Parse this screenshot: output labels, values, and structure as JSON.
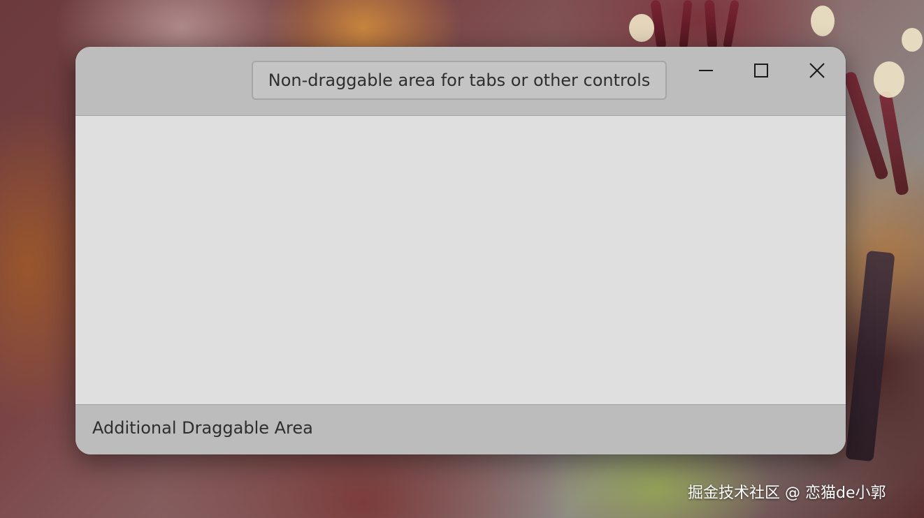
{
  "window": {
    "nondraggable_label": "Non-draggable area for tabs or other controls",
    "controls": {
      "minimize_icon": "minimize-icon",
      "maximize_icon": "maximize-icon",
      "close_icon": "close-icon"
    },
    "footer_label": "Additional Draggable Area"
  },
  "watermark": "掘金技术社区 @ 恋猫de小郭",
  "colors": {
    "titlebar": "#bdbdbd",
    "content": "#dfdfdf",
    "footer": "#bcbcbc",
    "text": "#2e2e2e"
  }
}
